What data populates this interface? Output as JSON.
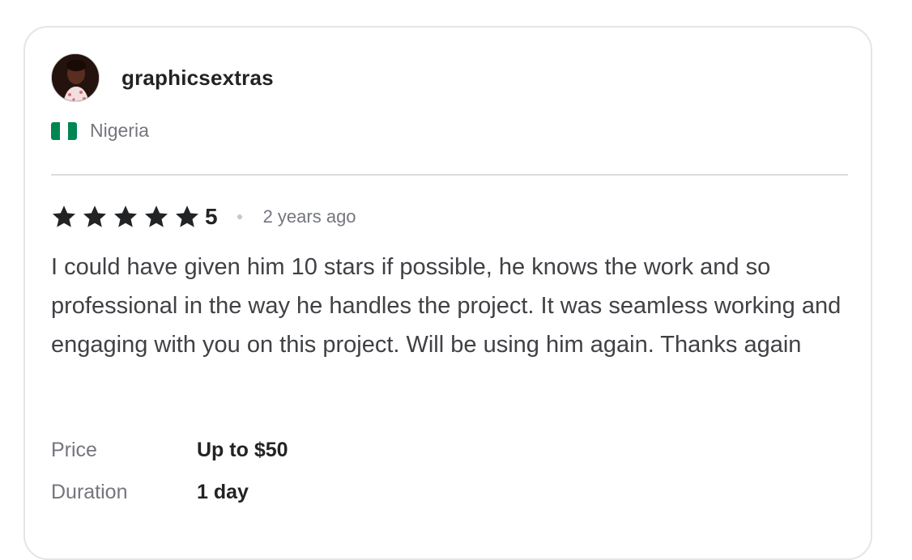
{
  "reviewer": {
    "username": "graphicsextras",
    "avatar_icon": "avatar-photo",
    "country": "Nigeria",
    "flag_colors": [
      "#008751",
      "#ffffff",
      "#008751"
    ]
  },
  "review": {
    "stars": 5,
    "rating_label": "5",
    "star_color": "#222325",
    "time_ago": "2 years ago",
    "text": "I could have given him 10 stars if possible, he knows the work and so professional in the way he handles the project. It was seamless working and engaging with you on this project. Will be using him again. Thanks again"
  },
  "details": [
    {
      "label": "Price",
      "value": "Up to $50"
    },
    {
      "label": "Duration",
      "value": "1 day"
    }
  ]
}
